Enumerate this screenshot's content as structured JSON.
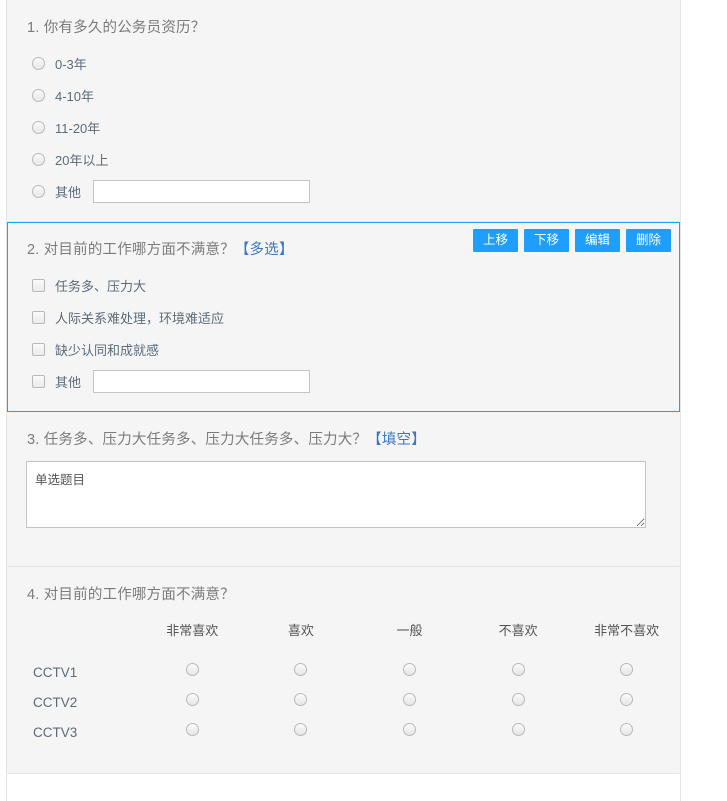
{
  "theme": {
    "page_bg": "#ffffff",
    "block_bg": "#f5f5f5",
    "selected_border": "#1e9fff",
    "button_bg": "#1e9fff",
    "tag_color": "#3a77c4",
    "title_color": "#7b7b7b",
    "label_color": "#5c6b7a"
  },
  "toolbar": {
    "move_up_label": "上移",
    "move_down_label": "下移",
    "edit_label": "编辑",
    "delete_label": "删除"
  },
  "questions": [
    {
      "number": "1.",
      "title": "你有多久的公务员资历？",
      "tag": "",
      "type": "radio",
      "selected": false,
      "options": [
        {
          "label": "0-3年",
          "has_input": false
        },
        {
          "label": "4-10年",
          "has_input": false
        },
        {
          "label": "11-20年",
          "has_input": false
        },
        {
          "label": "20年以上",
          "has_input": false
        },
        {
          "label": "其他",
          "has_input": true,
          "input_value": "",
          "input_placeholder": ""
        }
      ]
    },
    {
      "number": "2.",
      "title": "对目前的工作哪方面不满意？",
      "tag": "【多选】",
      "type": "checkbox",
      "selected": true,
      "options": [
        {
          "label": "任务多、压力大",
          "has_input": false
        },
        {
          "label": "人际关系难处理，环境难适应",
          "has_input": false
        },
        {
          "label": "缺少认同和成就感",
          "has_input": false
        },
        {
          "label": "其他",
          "has_input": true,
          "input_value": "",
          "input_placeholder": ""
        }
      ]
    },
    {
      "number": "3.",
      "title": "任务多、压力大任务多、压力大任务多、压力大？",
      "tag": "【填空】",
      "type": "textarea",
      "selected": false,
      "textarea_value": "单选题目",
      "textarea_placeholder": ""
    },
    {
      "number": "4.",
      "title": "对目前的工作哪方面不满意？",
      "tag": "",
      "type": "matrix",
      "selected": false,
      "matrix": {
        "columns": [
          "非常喜欢",
          "喜欢",
          "一般",
          "不喜欢",
          "非常不喜欢"
        ],
        "rows": [
          "CCTV1",
          "CCTV2",
          "CCTV3"
        ],
        "selections": [
          [
            false,
            false,
            false,
            false,
            false
          ],
          [
            false,
            false,
            false,
            false,
            false
          ],
          [
            false,
            false,
            false,
            false,
            false
          ]
        ]
      }
    }
  ]
}
